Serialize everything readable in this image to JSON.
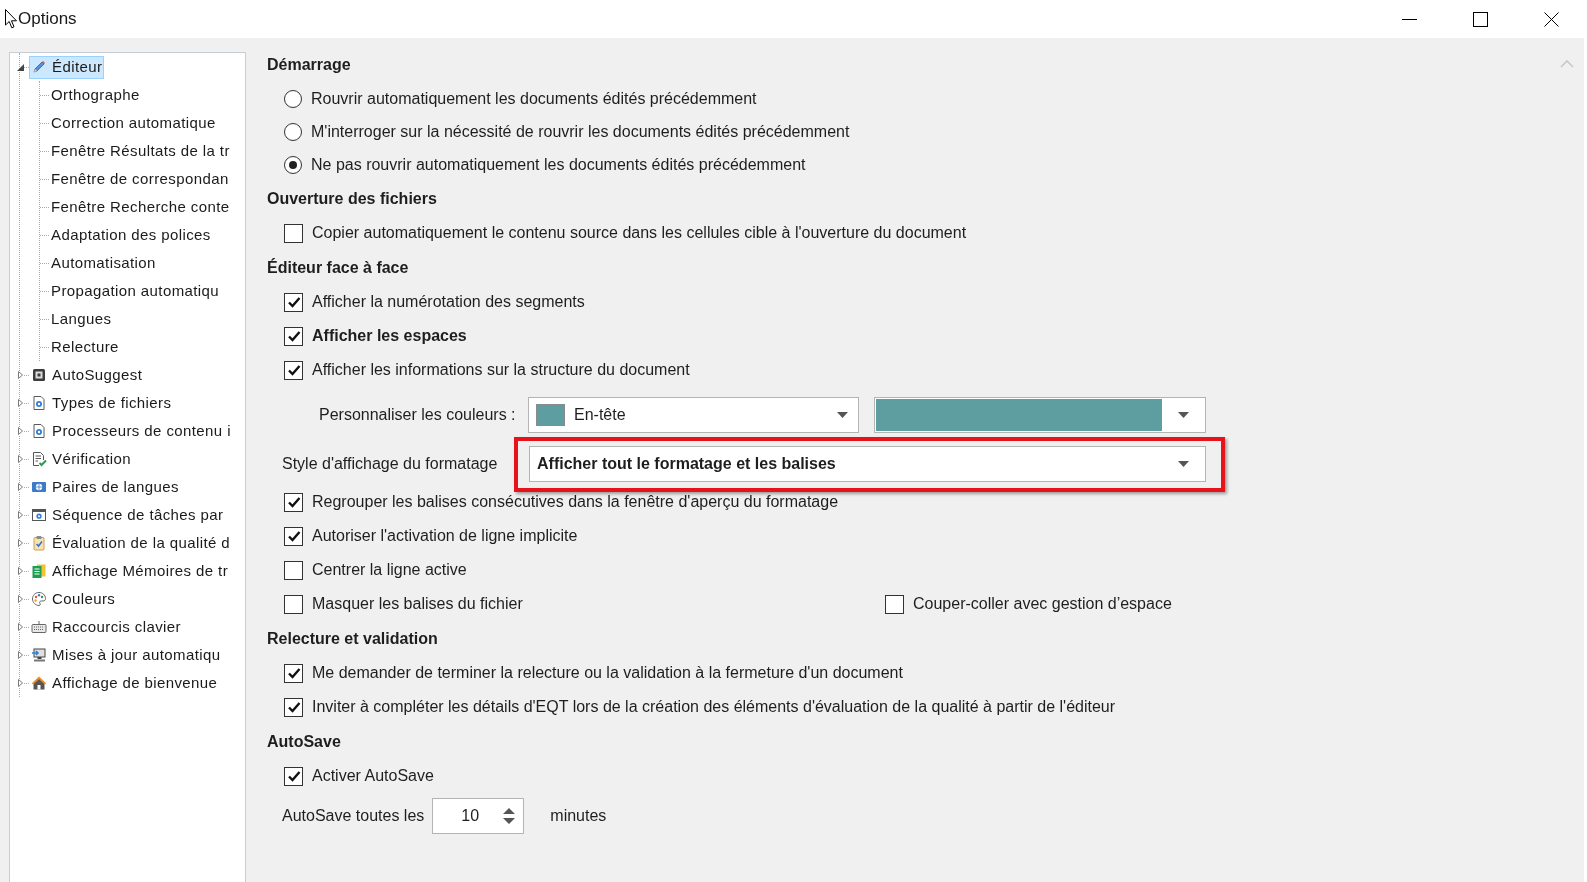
{
  "window": {
    "title": "Options"
  },
  "sidebar": {
    "items": [
      {
        "label": "Éditeur",
        "expanded": true,
        "selected": true,
        "children": [
          {
            "label": "Orthographe",
            "selected": false
          },
          {
            "label": "Correction automatique",
            "selected": false
          },
          {
            "label": "Fenêtre Résultats de la tr",
            "selected": false
          },
          {
            "label": "Fenêtre de correspondan",
            "selected": false
          },
          {
            "label": "Fenêtre Recherche conte",
            "selected": false
          },
          {
            "label": "Adaptation des polices",
            "selected": false
          },
          {
            "label": "Automatisation",
            "selected": false
          },
          {
            "label": "Propagation automatiqu",
            "selected": false
          },
          {
            "label": "Langues",
            "selected": false
          },
          {
            "label": "Relecture",
            "selected": false
          }
        ]
      },
      {
        "label": "AutoSuggest",
        "expanded": false,
        "selected": false
      },
      {
        "label": "Types de fichiers",
        "expanded": false,
        "selected": false
      },
      {
        "label": "Processeurs de contenu i",
        "expanded": false,
        "selected": false
      },
      {
        "label": "Vérification",
        "expanded": false,
        "selected": false
      },
      {
        "label": "Paires de langues",
        "expanded": false,
        "selected": false
      },
      {
        "label": "Séquence de tâches par",
        "expanded": false,
        "selected": false
      },
      {
        "label": "Évaluation de la qualité d",
        "expanded": false,
        "selected": false
      },
      {
        "label": "Affichage Mémoires de tr",
        "expanded": false,
        "selected": false
      },
      {
        "label": "Couleurs",
        "expanded": false,
        "selected": false
      },
      {
        "label": "Raccourcis clavier",
        "expanded": false,
        "selected": false
      },
      {
        "label": "Mises à jour automatiqu",
        "expanded": false,
        "selected": false
      },
      {
        "label": "Affichage de bienvenue",
        "expanded": false,
        "selected": false
      }
    ]
  },
  "sections": [
    {
      "title": "Démarrage",
      "rows": [
        {
          "kind": "radio",
          "label": "Rouvrir automatiquement les documents édités précédemment",
          "selected": false
        },
        {
          "kind": "radio",
          "label": "M'interroger sur la nécessité de rouvrir les documents édités précédemment",
          "selected": false
        },
        {
          "kind": "radio",
          "label": "Ne pas rouvrir automatiquement les documents édités précédemment",
          "selected": true
        }
      ]
    },
    {
      "title": "Ouverture des fichiers",
      "rows": [
        {
          "kind": "checkbox",
          "label": "Copier automatiquement le contenu source dans les cellules cible à l'ouverture du document",
          "checked": false
        }
      ]
    },
    {
      "title": "Éditeur face à face",
      "rows": [
        {
          "kind": "checkbox",
          "label": "Afficher la numérotation des segments",
          "checked": true
        },
        {
          "kind": "checkbox",
          "label": "Afficher les espaces",
          "checked": true,
          "bold": true
        },
        {
          "kind": "checkbox",
          "label": "Afficher les informations sur la structure du document",
          "checked": true
        },
        {
          "kind": "colors",
          "label": "Personnaliser les couleurs :",
          "element": {
            "value": "En-tête",
            "color": "#5f9ea0"
          },
          "color": "#5f9ea0"
        },
        {
          "kind": "select",
          "label": "Style d'affichage du formatage",
          "value": "Afficher tout le formatage et les balises",
          "highlighted": true
        },
        {
          "kind": "checkbox",
          "label": "Regrouper les balises consécutives dans la fenêtre d'aperçu du formatage",
          "checked": true
        },
        {
          "kind": "checkbox",
          "label": "Autoriser l'activation de ligne implicite",
          "checked": true
        },
        {
          "kind": "checkbox",
          "label": "Centrer la ligne active",
          "checked": false
        },
        {
          "kind": "checkbox_pair",
          "items": [
            {
              "label": "Masquer les balises du fichier",
              "checked": false
            },
            {
              "label": "Couper-coller avec gestion d’espace",
              "checked": false
            }
          ]
        }
      ]
    },
    {
      "title": "Relecture et validation",
      "rows": [
        {
          "kind": "checkbox",
          "label": "Me demander de terminer la relecture ou la validation à la fermeture d'un document",
          "checked": true
        },
        {
          "kind": "checkbox",
          "label": "Inviter à compléter les détails d'EQT lors de la création des éléments d'évaluation de la qualité à partir de l'éditeur",
          "checked": true
        }
      ]
    },
    {
      "title": "AutoSave",
      "rows": [
        {
          "kind": "checkbox",
          "label": "Activer AutoSave",
          "checked": true
        },
        {
          "kind": "spinner",
          "label": "AutoSave toutes les",
          "value": "10",
          "unit": "minutes"
        }
      ]
    }
  ]
}
